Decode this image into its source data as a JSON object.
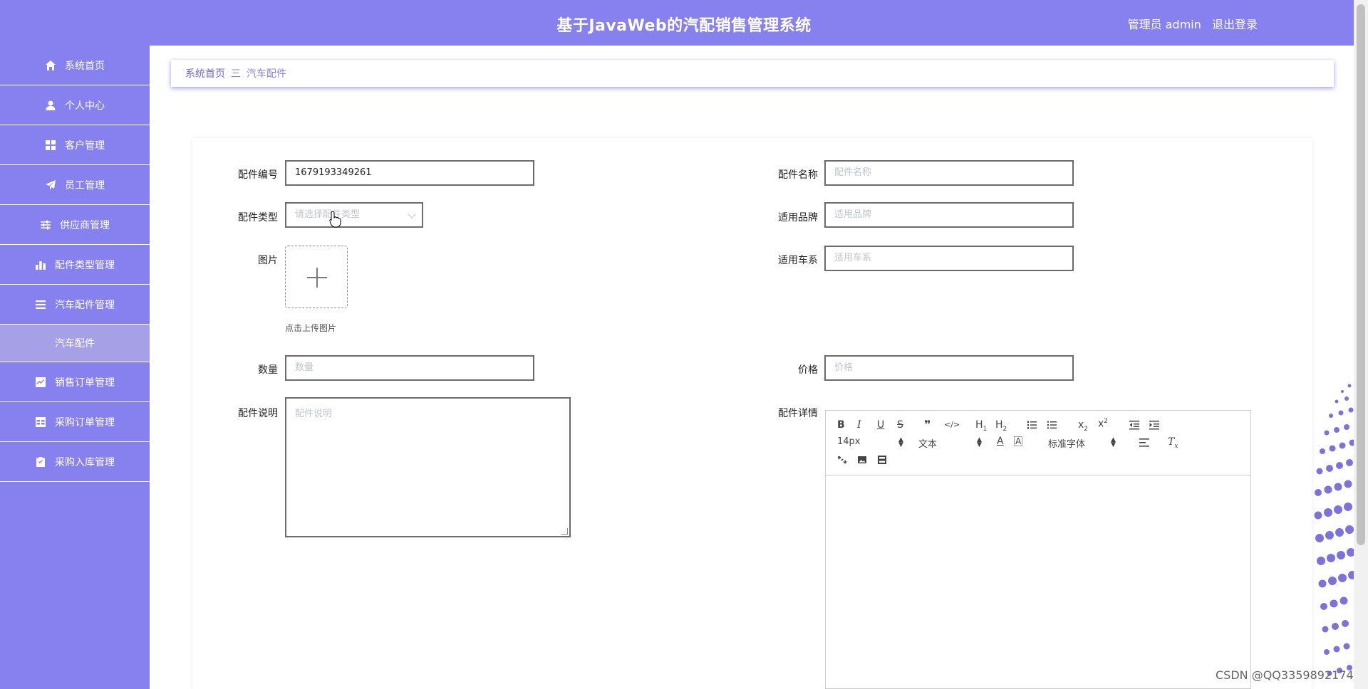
{
  "header": {
    "title": "基于JavaWeb的汽配销售管理系统",
    "user_text": "管理员 admin",
    "logout_label": "退出登录"
  },
  "sidebar": {
    "items": [
      {
        "label": "系统首页",
        "icon": "home-icon"
      },
      {
        "label": "个人中心",
        "icon": "user-icon"
      },
      {
        "label": "客户管理",
        "icon": "grid-icon"
      },
      {
        "label": "员工管理",
        "icon": "paper-plane-icon"
      },
      {
        "label": "供应商管理",
        "icon": "sliders-icon"
      },
      {
        "label": "配件类型管理",
        "icon": "bar-chart-icon"
      },
      {
        "label": "汽车配件管理",
        "icon": "list-icon"
      },
      {
        "label": "销售订单管理",
        "icon": "chart-check-icon"
      },
      {
        "label": "采购订单管理",
        "icon": "table-icon"
      },
      {
        "label": "采购入库管理",
        "icon": "clipboard-icon"
      }
    ],
    "active_sub": "汽车配件"
  },
  "breadcrumb": {
    "home": "系统首页",
    "separator": "三",
    "current": "汽车配件"
  },
  "form": {
    "part_no": {
      "label": "配件编号",
      "value": "1679193349261"
    },
    "part_name": {
      "label": "配件名称",
      "placeholder": "配件名称"
    },
    "part_type": {
      "label": "配件类型",
      "placeholder": "请选择配件类型"
    },
    "brand": {
      "label": "适用品牌",
      "placeholder": "适用品牌"
    },
    "image": {
      "label": "图片",
      "hint": "点击上传图片"
    },
    "car_series": {
      "label": "适用车系",
      "placeholder": "适用车系"
    },
    "quantity": {
      "label": "数量",
      "placeholder": "数量"
    },
    "price": {
      "label": "价格",
      "placeholder": "价格"
    },
    "description": {
      "label": "配件说明",
      "placeholder": "配件说明"
    },
    "details": {
      "label": "配件详情"
    }
  },
  "editor": {
    "font_size": "14px",
    "header_select": "文本",
    "font_family": "标准字体",
    "buttons": [
      "B",
      "I",
      "U",
      "S",
      "❞",
      "</>",
      "H1",
      "H2",
      "ol",
      "ul",
      "x2",
      "x²",
      "outdent",
      "indent",
      "A",
      "A-bg",
      "align",
      "Tx",
      "link",
      "image",
      "video"
    ]
  },
  "watermark": "CSDN @QQ3359892174",
  "colors": {
    "primary": "#8681ee",
    "sub_active": "#a6a1e6"
  }
}
